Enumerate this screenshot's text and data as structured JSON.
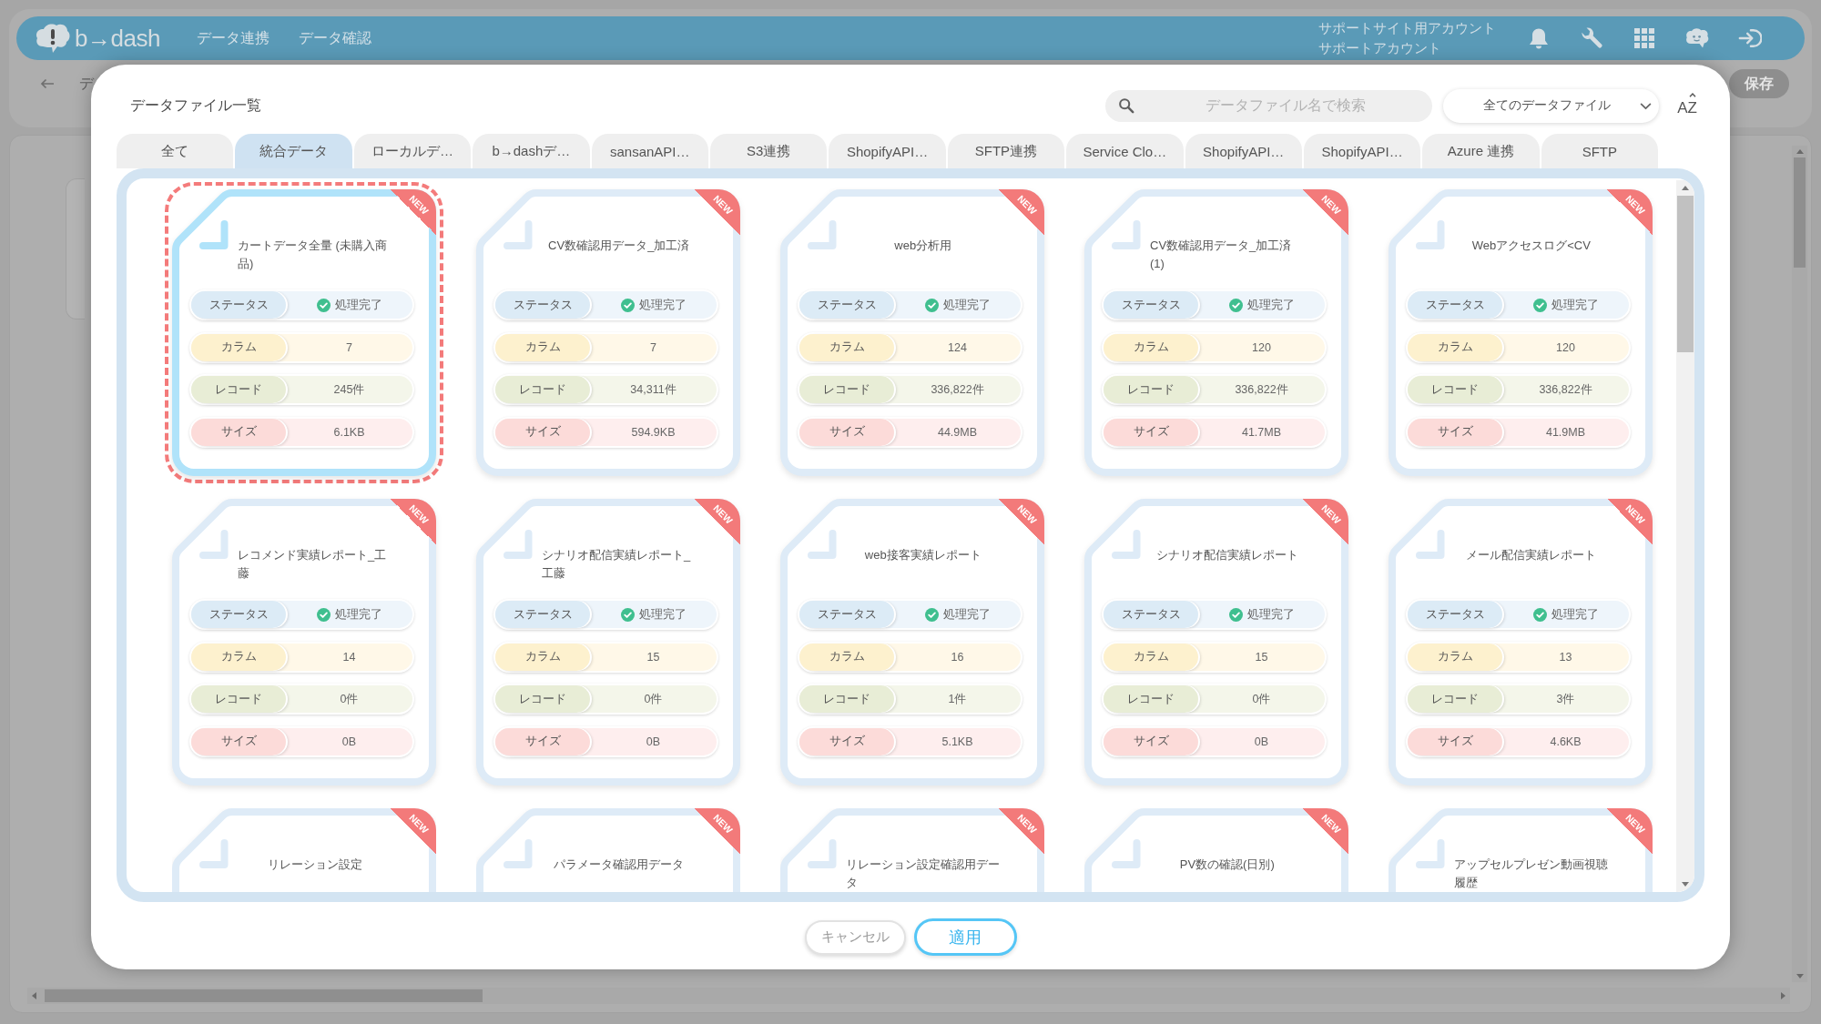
{
  "app_header": {
    "logo": "b→dash",
    "nav": [
      "データ連携",
      "データ確認"
    ],
    "account": [
      "サポートサイト用アカウント",
      "サポートアカウント"
    ]
  },
  "toolbar": {
    "page_title": "デ",
    "save_button": "保存"
  },
  "dialog": {
    "title": "データファイル一覧",
    "search": {
      "placeholder": "データファイル名で検索"
    },
    "filter": {
      "value": "全てのデータファイル"
    },
    "sort_button": "AZ",
    "tabs": [
      {
        "label": "全て",
        "selected": false
      },
      {
        "label": "統合データ",
        "selected": true
      },
      {
        "label": "ローカルデ…",
        "selected": false
      },
      {
        "label": "b→dashデ…",
        "selected": false
      },
      {
        "label": "sansanAPI…",
        "selected": false
      },
      {
        "label": "S3連携",
        "selected": false
      },
      {
        "label": "ShopifyAPI…",
        "selected": false
      },
      {
        "label": "SFTP連携",
        "selected": false
      },
      {
        "label": "Service Clo…",
        "selected": false
      },
      {
        "label": "ShopifyAPI…",
        "selected": false
      },
      {
        "label": "ShopifyAPI…",
        "selected": false
      },
      {
        "label": "Azure 連携",
        "selected": false
      },
      {
        "label": "SFTP",
        "selected": false
      }
    ],
    "files": [
      {
        "name": "カートデータ全量 (未購入商品)",
        "badge": "NEW",
        "selected": true,
        "fields": [
          {
            "kind": "status",
            "label": "ステータス",
            "value": "処理完了"
          },
          {
            "kind": "columns",
            "label": "カラム",
            "value": "7"
          },
          {
            "kind": "records",
            "label": "レコード",
            "value": "245件"
          },
          {
            "kind": "size",
            "label": "サイズ",
            "value": "6.1KB"
          }
        ]
      },
      {
        "name": "CV数確認用データ_加工済",
        "badge": "NEW",
        "selected": false,
        "fields": [
          {
            "kind": "status",
            "label": "ステータス",
            "value": "処理完了"
          },
          {
            "kind": "columns",
            "label": "カラム",
            "value": "7"
          },
          {
            "kind": "records",
            "label": "レコード",
            "value": "34,311件"
          },
          {
            "kind": "size",
            "label": "サイズ",
            "value": "594.9KB"
          }
        ]
      },
      {
        "name": "web分析用",
        "badge": "NEW",
        "selected": false,
        "fields": [
          {
            "kind": "status",
            "label": "ステータス",
            "value": "処理完了"
          },
          {
            "kind": "columns",
            "label": "カラム",
            "value": "124"
          },
          {
            "kind": "records",
            "label": "レコード",
            "value": "336,822件"
          },
          {
            "kind": "size",
            "label": "サイズ",
            "value": "44.9MB"
          }
        ]
      },
      {
        "name": "CV数確認用データ_加工済(1)",
        "badge": "NEW",
        "selected": false,
        "fields": [
          {
            "kind": "status",
            "label": "ステータス",
            "value": "処理完了"
          },
          {
            "kind": "columns",
            "label": "カラム",
            "value": "120"
          },
          {
            "kind": "records",
            "label": "レコード",
            "value": "336,822件"
          },
          {
            "kind": "size",
            "label": "サイズ",
            "value": "41.7MB"
          }
        ]
      },
      {
        "name": "Webアクセスログ<CV",
        "badge": "NEW",
        "selected": false,
        "fields": [
          {
            "kind": "status",
            "label": "ステータス",
            "value": "処理完了"
          },
          {
            "kind": "columns",
            "label": "カラム",
            "value": "120"
          },
          {
            "kind": "records",
            "label": "レコード",
            "value": "336,822件"
          },
          {
            "kind": "size",
            "label": "サイズ",
            "value": "41.9MB"
          }
        ]
      },
      {
        "name": "レコメンド実績レポート_工藤",
        "badge": "NEW",
        "selected": false,
        "fields": [
          {
            "kind": "status",
            "label": "ステータス",
            "value": "処理完了"
          },
          {
            "kind": "columns",
            "label": "カラム",
            "value": "14"
          },
          {
            "kind": "records",
            "label": "レコード",
            "value": "0件"
          },
          {
            "kind": "size",
            "label": "サイズ",
            "value": "0B"
          }
        ]
      },
      {
        "name": "シナリオ配信実績レポート_工藤",
        "badge": "NEW",
        "selected": false,
        "fields": [
          {
            "kind": "status",
            "label": "ステータス",
            "value": "処理完了"
          },
          {
            "kind": "columns",
            "label": "カラム",
            "value": "15"
          },
          {
            "kind": "records",
            "label": "レコード",
            "value": "0件"
          },
          {
            "kind": "size",
            "label": "サイズ",
            "value": "0B"
          }
        ]
      },
      {
        "name": "web接客実績レポート",
        "badge": "NEW",
        "selected": false,
        "fields": [
          {
            "kind": "status",
            "label": "ステータス",
            "value": "処理完了"
          },
          {
            "kind": "columns",
            "label": "カラム",
            "value": "16"
          },
          {
            "kind": "records",
            "label": "レコード",
            "value": "1件"
          },
          {
            "kind": "size",
            "label": "サイズ",
            "value": "5.1KB"
          }
        ]
      },
      {
        "name": "シナリオ配信実績レポート",
        "badge": "NEW",
        "selected": false,
        "fields": [
          {
            "kind": "status",
            "label": "ステータス",
            "value": "処理完了"
          },
          {
            "kind": "columns",
            "label": "カラム",
            "value": "15"
          },
          {
            "kind": "records",
            "label": "レコード",
            "value": "0件"
          },
          {
            "kind": "size",
            "label": "サイズ",
            "value": "0B"
          }
        ]
      },
      {
        "name": "メール配信実績レポート",
        "badge": "NEW",
        "selected": false,
        "fields": [
          {
            "kind": "status",
            "label": "ステータス",
            "value": "処理完了"
          },
          {
            "kind": "columns",
            "label": "カラム",
            "value": "13"
          },
          {
            "kind": "records",
            "label": "レコード",
            "value": "3件"
          },
          {
            "kind": "size",
            "label": "サイズ",
            "value": "4.6KB"
          }
        ]
      },
      {
        "name": "リレーション設定",
        "badge": "NEW",
        "selected": false
      },
      {
        "name": "パラメータ確認用データ",
        "badge": "NEW",
        "selected": false
      },
      {
        "name": "リレーション設定確認用データ",
        "badge": "NEW",
        "selected": false
      },
      {
        "name": "PV数の確認(日別)",
        "badge": "NEW",
        "selected": false
      },
      {
        "name": "アップセルプレゼン動画視聴履歴",
        "badge": "NEW",
        "selected": false
      }
    ],
    "buttons": [
      {
        "label": "キャンセル",
        "kind": "cancel"
      },
      {
        "label": "適用",
        "kind": "apply"
      }
    ]
  }
}
